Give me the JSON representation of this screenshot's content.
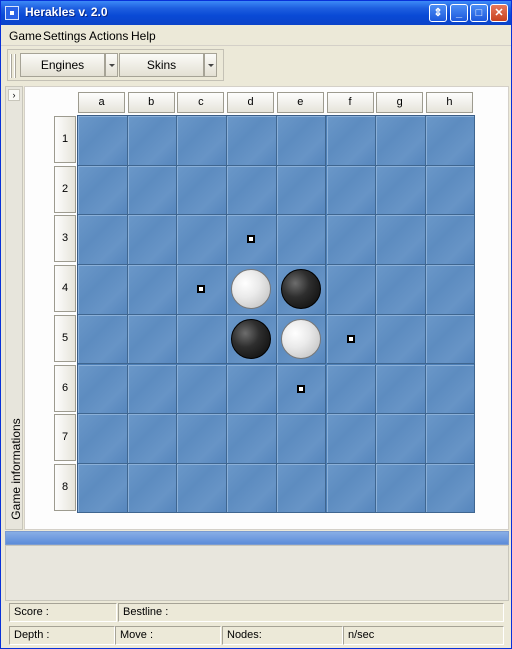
{
  "window": {
    "title": "Herakles v. 2.0"
  },
  "menu": [
    "Game",
    "Settings",
    "Actions",
    "Help"
  ],
  "toolbar": {
    "engines_label": "Engines",
    "skins_label": "Skins"
  },
  "side_panel": {
    "label": "Game informations",
    "toggle": "›"
  },
  "board": {
    "columns": [
      "a",
      "b",
      "c",
      "d",
      "e",
      "f",
      "g",
      "h"
    ],
    "rows": [
      "1",
      "2",
      "3",
      "4",
      "5",
      "6",
      "7",
      "8"
    ],
    "pieces": [
      {
        "square": "d4",
        "color": "white"
      },
      {
        "square": "e4",
        "color": "black"
      },
      {
        "square": "d5",
        "color": "black"
      },
      {
        "square": "e5",
        "color": "white"
      }
    ],
    "hints": [
      "d3",
      "c4",
      "f5",
      "e6"
    ],
    "colors": {
      "board": "#5d8cc0",
      "grid": "#3f6690"
    }
  },
  "status": {
    "score_label": "Score :",
    "bestline_label": "Bestline :",
    "depth_label": "Depth :",
    "move_label": "Move :",
    "nodes_label": "Nodes:",
    "nps_label": "n/sec"
  }
}
